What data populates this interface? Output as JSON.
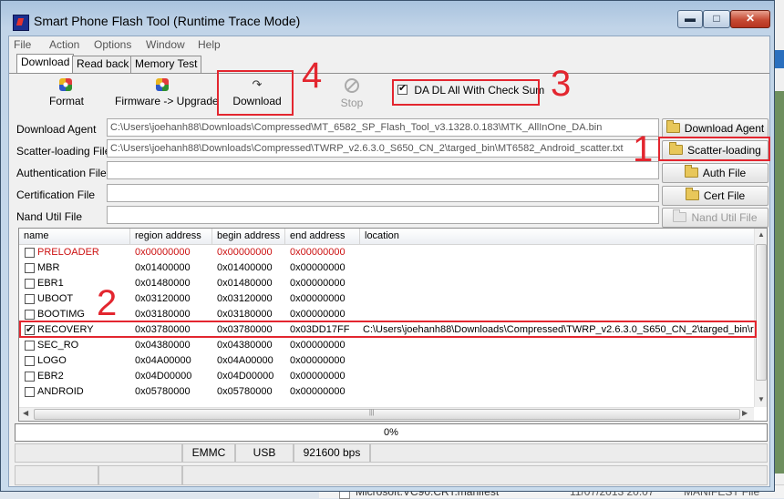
{
  "window": {
    "title": "Smart Phone Flash Tool (Runtime Trace Mode)",
    "min_glyph": "▬",
    "max_glyph": "□",
    "close_glyph": "✕"
  },
  "menu": [
    "File",
    "Action",
    "Options",
    "Window",
    "Help"
  ],
  "tabs": [
    {
      "label": "Download",
      "active": true
    },
    {
      "label": "Read back",
      "active": false
    },
    {
      "label": "Memory Test",
      "active": false
    }
  ],
  "toolbar": {
    "format": "Format",
    "firmware_upgrade": "Firmware -> Upgrade",
    "download": "Download",
    "stop": "Stop",
    "checksum_label": "DA DL All With Check Sum",
    "checksum_checked": true
  },
  "files": {
    "download_agent": {
      "label": "Download Agent",
      "value": "C:\\Users\\joehanh88\\Downloads\\Compressed\\MT_6582_SP_Flash_Tool_v3.1328.0.183\\MTK_AllInOne_DA.bin",
      "button": "Download Agent"
    },
    "scatter_loading": {
      "label": "Scatter-loading File",
      "value": "C:\\Users\\joehanh88\\Downloads\\Compressed\\TWRP_v2.6.3.0_S650_CN_2\\targed_bin\\MT6582_Android_scatter.txt",
      "button": "Scatter-loading"
    },
    "authentication": {
      "label": "Authentication File",
      "value": "",
      "button": "Auth File"
    },
    "certification": {
      "label": "Certification File",
      "value": "",
      "button": "Cert File"
    },
    "nand_util": {
      "label": "Nand Util File",
      "value": "",
      "button": "Nand Util File"
    }
  },
  "table": {
    "columns": [
      "name",
      "region address",
      "begin address",
      "end address",
      "location"
    ],
    "rows": [
      {
        "name": "PRELOADER",
        "region": "0x00000000",
        "begin": "0x00000000",
        "end": "0x00000000",
        "location": "",
        "checked": false,
        "red": true
      },
      {
        "name": "MBR",
        "region": "0x01400000",
        "begin": "0x01400000",
        "end": "0x00000000",
        "location": "",
        "checked": false,
        "red": false
      },
      {
        "name": "EBR1",
        "region": "0x01480000",
        "begin": "0x01480000",
        "end": "0x00000000",
        "location": "",
        "checked": false,
        "red": false
      },
      {
        "name": "UBOOT",
        "region": "0x03120000",
        "begin": "0x03120000",
        "end": "0x00000000",
        "location": "",
        "checked": false,
        "red": false
      },
      {
        "name": "BOOTIMG",
        "region": "0x03180000",
        "begin": "0x03180000",
        "end": "0x00000000",
        "location": "",
        "checked": false,
        "red": false
      },
      {
        "name": "RECOVERY",
        "region": "0x03780000",
        "begin": "0x03780000",
        "end": "0x03DD17FF",
        "location": "C:\\Users\\joehanh88\\Downloads\\Compressed\\TWRP_v2.6.3.0_S650_CN_2\\targed_bin\\r",
        "checked": true,
        "red": false
      },
      {
        "name": "SEC_RO",
        "region": "0x04380000",
        "begin": "0x04380000",
        "end": "0x00000000",
        "location": "",
        "checked": false,
        "red": false
      },
      {
        "name": "LOGO",
        "region": "0x04A00000",
        "begin": "0x04A00000",
        "end": "0x00000000",
        "location": "",
        "checked": false,
        "red": false
      },
      {
        "name": "EBR2",
        "region": "0x04D00000",
        "begin": "0x04D00000",
        "end": "0x00000000",
        "location": "",
        "checked": false,
        "red": false
      },
      {
        "name": "ANDROID",
        "region": "0x05780000",
        "begin": "0x05780000",
        "end": "0x00000000",
        "location": "",
        "checked": false,
        "red": false
      }
    ]
  },
  "progress": {
    "text": "0%",
    "value": 0
  },
  "status": {
    "storage": "EMMC",
    "port": "USB",
    "baud": "921600 bps"
  },
  "annotations": {
    "one": "1",
    "two": "2",
    "three": "3",
    "four": "4"
  },
  "background": {
    "text": "Microsoft.VC90.CRT.manifest",
    "date": "11/07/2013 20:07",
    "type": "MANIFEST File"
  },
  "colors": {
    "annotation": "#e3262f",
    "preloader_text": "#cc1111",
    "close_button": "#c64a33"
  }
}
